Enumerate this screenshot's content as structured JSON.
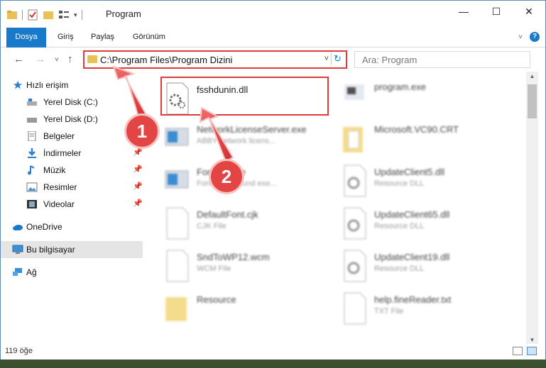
{
  "window": {
    "title": "Program",
    "controls": {
      "minimize": "—",
      "maximize": "☐",
      "close": "✕"
    }
  },
  "ribbon": {
    "tabs": [
      "Dosya",
      "Giriş",
      "Paylaş",
      "Görünüm"
    ],
    "help": "?"
  },
  "nav": {
    "back": "←",
    "forward": "→",
    "recent": "˅",
    "up": "↑",
    "address": "C:\\Program Files\\Program Dizini",
    "dropdown": "˅",
    "refresh": "↻",
    "search_placeholder": "Ara: Program"
  },
  "sidebar": {
    "items": [
      {
        "label": "Hızlı erişim",
        "icon": "star-icon",
        "pinned": false
      },
      {
        "label": "Yerel Disk (C:)",
        "icon": "drive-icon",
        "pinned": false
      },
      {
        "label": "Yerel Disk (D:)",
        "icon": "drive-icon",
        "pinned": false
      },
      {
        "label": "Belgeler",
        "icon": "document-icon",
        "pinned": false
      },
      {
        "label": "İndirmeler",
        "icon": "download-icon",
        "pinned": true
      },
      {
        "label": "Müzik",
        "icon": "music-icon",
        "pinned": true
      },
      {
        "label": "Resimler",
        "icon": "pictures-icon",
        "pinned": true
      },
      {
        "label": "Videolar",
        "icon": "video-icon",
        "pinned": true
      },
      {
        "label": "OneDrive",
        "icon": "cloud-icon",
        "pinned": false
      },
      {
        "label": "Bu bilgisayar",
        "icon": "computer-icon",
        "pinned": false
      },
      {
        "label": "Ağ",
        "icon": "network-icon",
        "pinned": false
      }
    ]
  },
  "files": [
    {
      "name": "fsshdunin.dll",
      "type": "",
      "icon": "dll-icon",
      "highlighted": true
    },
    {
      "name": "program.exe",
      "type": "",
      "icon": "exe-icon"
    },
    {
      "name": "NetworkLicenseServer.exe",
      "type": "ABBY network licens...",
      "icon": "exe-icon"
    },
    {
      "name": "Microsoft.VC90.CRT",
      "type": "",
      "icon": "folder-icon"
    },
    {
      "name": "FontSrv.exe",
      "type": "Font background exe...",
      "icon": "exe-icon"
    },
    {
      "name": "UpdateClient5.dll",
      "type": "Resource DLL",
      "icon": "dll-icon"
    },
    {
      "name": "DefaultFont.cjk",
      "type": "CJK File",
      "icon": "file-icon"
    },
    {
      "name": "UpdateClient65.dll",
      "type": "Resource DLL",
      "icon": "dll-icon"
    },
    {
      "name": "SndToWP12.wcm",
      "type": "WCM File",
      "icon": "file-icon"
    },
    {
      "name": "UpdateClient19.dll",
      "type": "Resource DLL",
      "icon": "dll-icon"
    },
    {
      "name": "Resource",
      "type": "",
      "icon": "folder-icon"
    },
    {
      "name": "help.fineReader.txt",
      "type": "TXT File",
      "icon": "txt-icon"
    }
  ],
  "status": {
    "count": "119 öğe"
  },
  "annotations": {
    "step1": "1",
    "step2": "2"
  },
  "colors": {
    "accent": "#1979ca",
    "highlight": "#e03b3b",
    "badge": "#e34444"
  }
}
